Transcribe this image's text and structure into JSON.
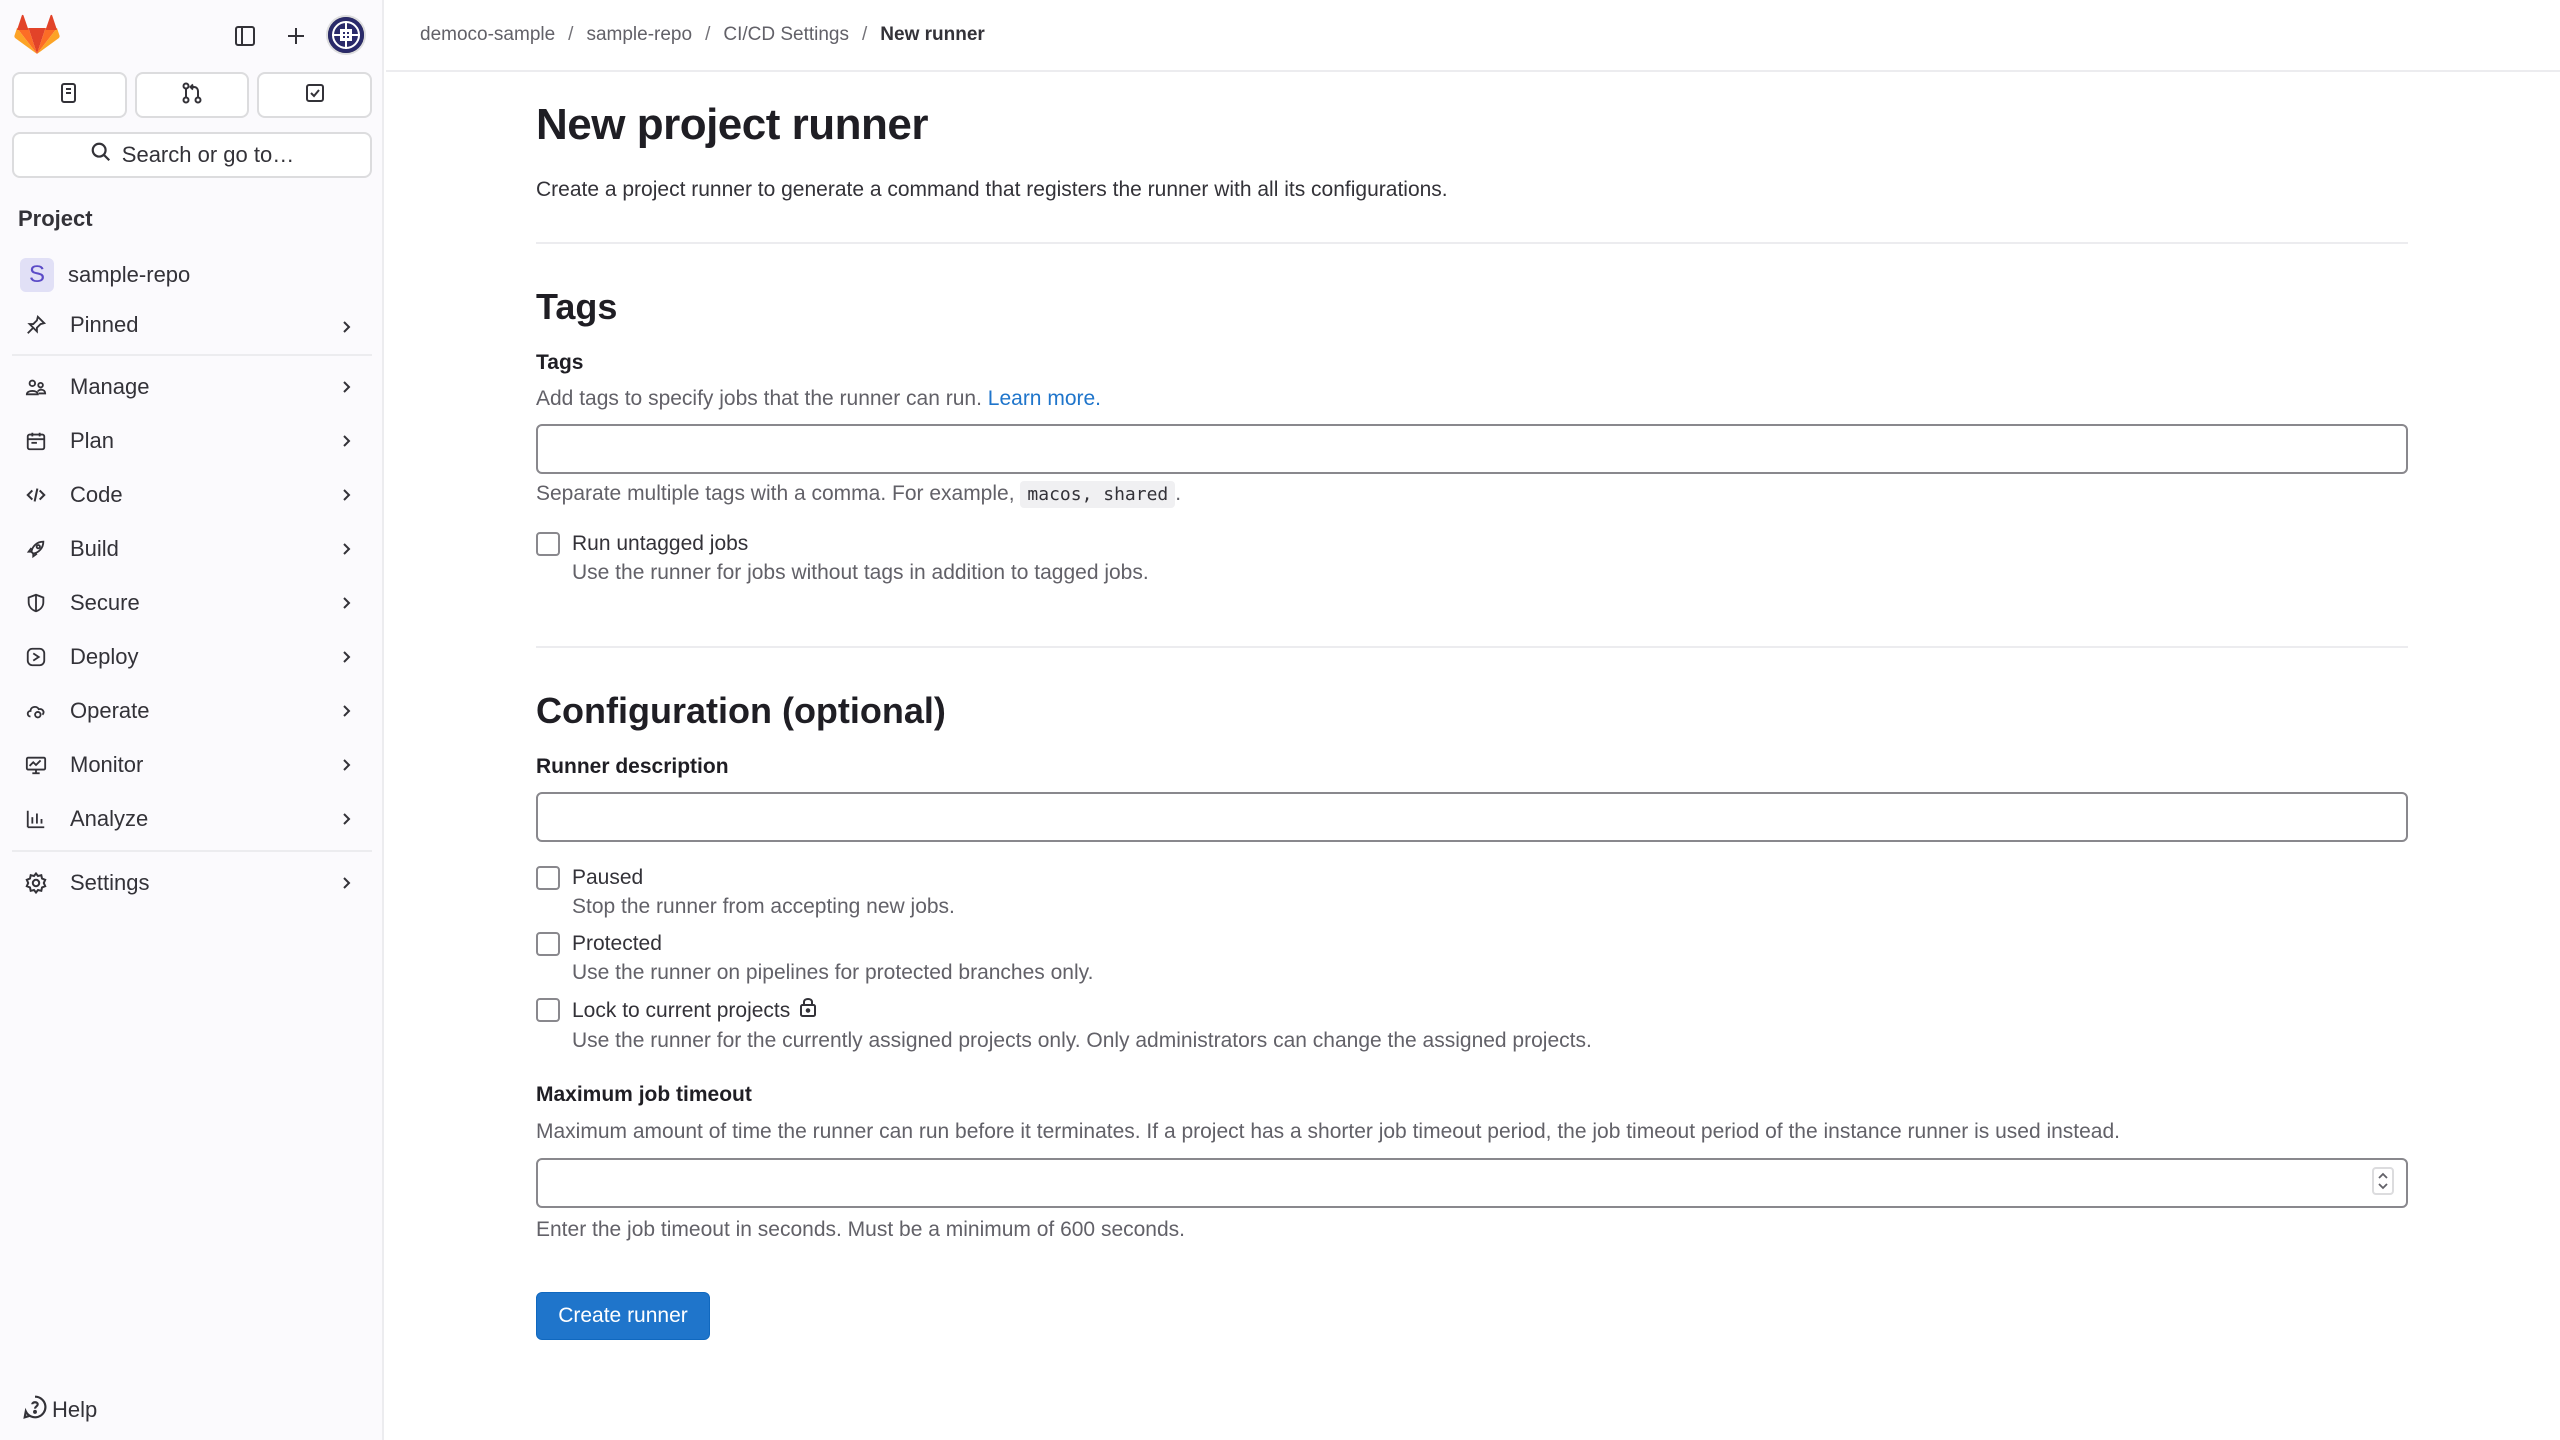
{
  "sidebar": {
    "search_label": "Search or go to…",
    "section_title": "Project",
    "project": {
      "badge": "S",
      "name": "sample-repo"
    },
    "items": [
      {
        "label": "Pinned",
        "icon": "pin-icon"
      },
      {
        "label": "Manage",
        "icon": "users-icon"
      },
      {
        "label": "Plan",
        "icon": "calendar-icon"
      },
      {
        "label": "Code",
        "icon": "code-icon"
      },
      {
        "label": "Build",
        "icon": "rocket-icon"
      },
      {
        "label": "Secure",
        "icon": "shield-icon"
      },
      {
        "label": "Deploy",
        "icon": "deploy-icon"
      },
      {
        "label": "Operate",
        "icon": "cloud-icon"
      },
      {
        "label": "Monitor",
        "icon": "monitor-icon"
      },
      {
        "label": "Analyze",
        "icon": "chart-icon"
      },
      {
        "label": "Settings",
        "icon": "gear-icon"
      }
    ],
    "help_label": "Help"
  },
  "breadcrumb": [
    "democo-sample",
    "sample-repo",
    "CI/CD Settings",
    "New runner"
  ],
  "page": {
    "title": "New project runner",
    "description": "Create a project runner to generate a command that registers the runner with all its configurations."
  },
  "tags_section": {
    "heading": "Tags",
    "label": "Tags",
    "help_text": "Add tags to specify jobs that the runner can run.",
    "help_link": "Learn more.",
    "input_value": "",
    "hint_prefix": "Separate multiple tags with a comma. For example,",
    "hint_code": "macos, shared",
    "hint_suffix": ".",
    "untagged": {
      "label": "Run untagged jobs",
      "description": "Use the runner for jobs without tags in addition to tagged jobs.",
      "checked": false
    }
  },
  "config_section": {
    "heading": "Configuration (optional)",
    "description_label": "Runner description",
    "description_value": "",
    "options": [
      {
        "label": "Paused",
        "description": "Stop the runner from accepting new jobs.",
        "checked": false
      },
      {
        "label": "Protected",
        "description": "Use the runner on pipelines for protected branches only.",
        "checked": false
      },
      {
        "label": "Lock to current projects",
        "description": "Use the runner for the currently assigned projects only. Only administrators can change the assigned projects.",
        "checked": false,
        "icon": "lock-icon"
      }
    ],
    "timeout_label": "Maximum job timeout",
    "timeout_help": "Maximum amount of time the runner can run before it terminates. If a project has a shorter job timeout period, the job timeout period of the instance runner is used instead.",
    "timeout_value": "",
    "timeout_hint": "Enter the job timeout in seconds. Must be a minimum of 600 seconds."
  },
  "submit_label": "Create runner",
  "colors": {
    "primary": "#1f75cb",
    "sidebar_bg": "#fbfafd",
    "logo_orange": "#e24329"
  }
}
